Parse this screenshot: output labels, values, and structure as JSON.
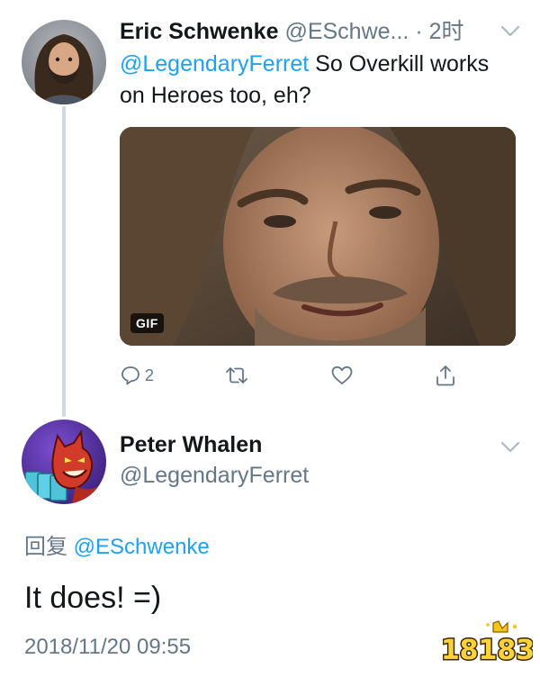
{
  "tweet": {
    "author": {
      "display_name": "Eric Schwenke",
      "handle": "@ESchwe...",
      "separator": "·",
      "time_ago": "2时"
    },
    "text": {
      "mention": "@LegendaryFerret",
      "body": " So Overkill works on Heroes too, eh?"
    },
    "media": {
      "badge": "GIF"
    },
    "actions": {
      "reply_count": "2"
    }
  },
  "reply": {
    "author": {
      "display_name": "Peter Whalen",
      "handle": "@LegendaryFerret"
    },
    "reply_prefix": "回复",
    "reply_mention": "@ESchwenke",
    "body": "It does! =)",
    "timestamp": "2018/11/20 09:55"
  },
  "watermark": {
    "text": "18183"
  },
  "colors": {
    "link": "#1da1f2",
    "muted": "#657786",
    "text": "#14171a",
    "thread_line": "#cfd9de"
  },
  "icons": {
    "reply": "reply-icon",
    "retweet": "retweet-icon",
    "like": "heart-icon",
    "share": "share-icon",
    "chevron": "chevron-down-icon"
  }
}
